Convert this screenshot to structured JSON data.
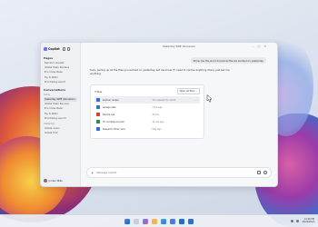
{
  "app": {
    "name": "Copilot"
  },
  "chat": {
    "title": "Yesterday SWE discussion"
  },
  "sidebar": {
    "pages_header": "Pages",
    "pages": [
      "Random request",
      "Global Team Nucleus",
      "Eco Crew Ideas",
      "Tip to Nikki",
      "Prioritizing launch"
    ],
    "conversations_header": "Conversations",
    "today_label": "Today",
    "today": [
      "Yesterday SWE discussion",
      "Global Team Reunion",
      "Eco Crew Ideas",
      "Tip to Nikki",
      "Prioritizing Launch"
    ],
    "yesterday_label": "Yesterday",
    "yesterday": [
      "Global vision",
      "Global Fork"
    ],
    "user": "Jordan Wills"
  },
  "messages": {
    "user": "Show me the word doc/excel file we worked on yesterday",
    "bot": "Sure, pulling up all the files you worked on yesterday. Let me know if I need to narrow anything down, just ask me anything."
  },
  "files": {
    "count_label": "3 files",
    "open_label": "Open all files",
    "items": [
      {
        "name": "Sunbun recipe",
        "meta": "You opened it in word",
        "color": "#2f6fd0"
      },
      {
        "name": "Garage sale",
        "meta": "2 hrs ago",
        "color": "#2f6fd0"
      },
      {
        "name": "Bizarre ops",
        "meta": "20 hrs",
        "color": "#c8443a"
      },
      {
        "name": "Pit compliance plan",
        "meta": "21 hrs ago",
        "color": "#2f8a56"
      },
      {
        "name": "Research other race",
        "meta": "Day ago",
        "color": "#2f6fd0"
      }
    ]
  },
  "input": {
    "placeholder": "Message Copilot"
  },
  "taskbar": {
    "time": "12:40 PM",
    "date": "10/24/2024"
  }
}
